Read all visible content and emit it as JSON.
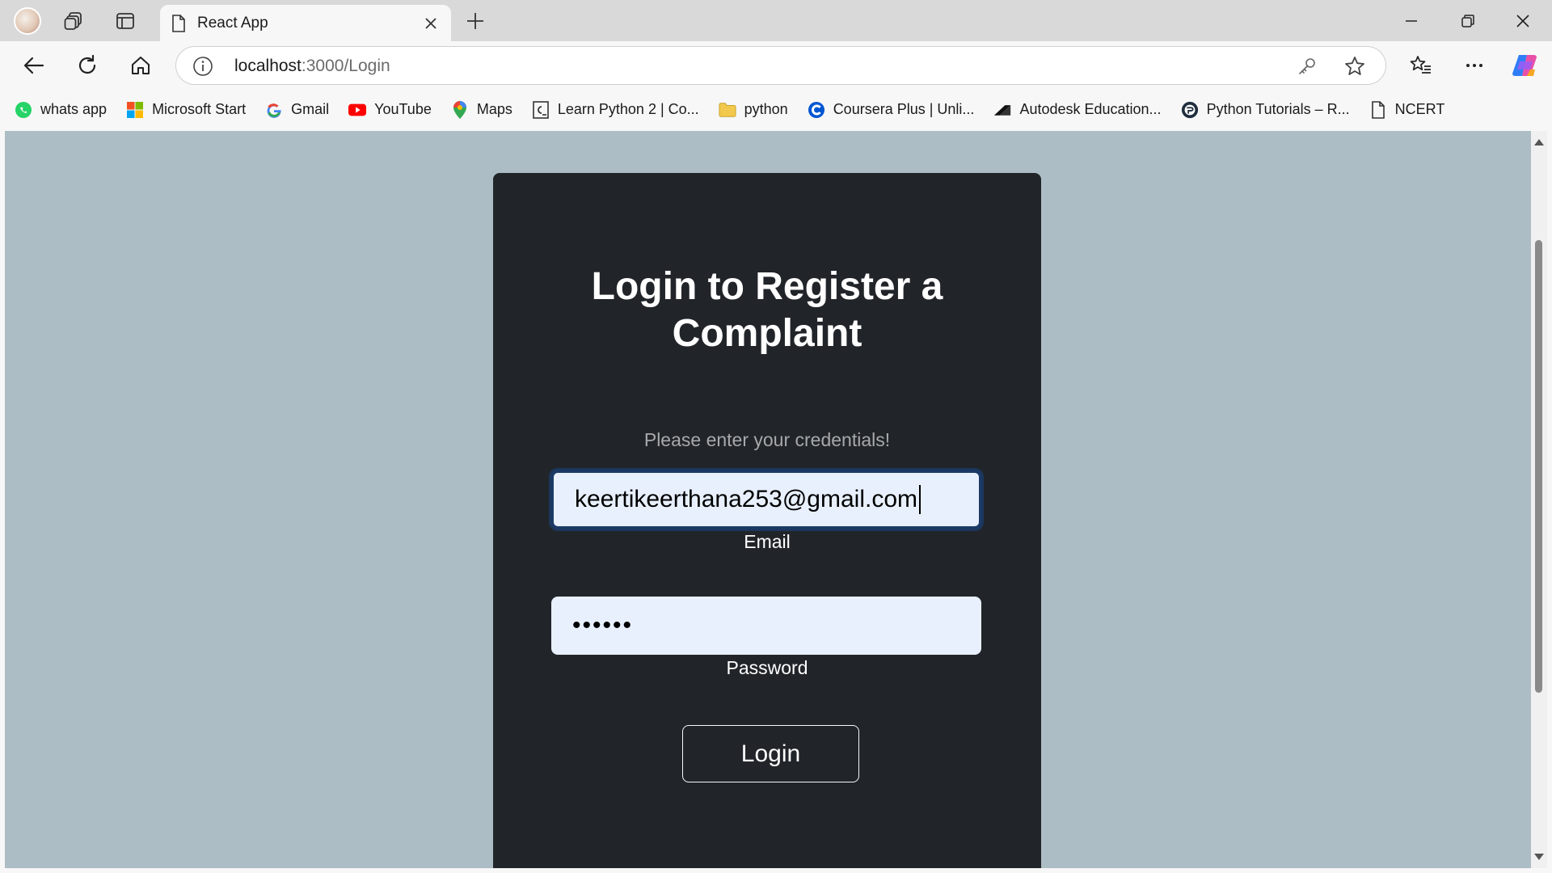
{
  "browser": {
    "tab": {
      "title": "React App",
      "icon": "page-icon"
    },
    "address": {
      "host": "localhost",
      "path": ":3000/Login"
    },
    "bookmarks": [
      {
        "label": "whats app",
        "icon": "whatsapp-icon",
        "color": "#25d366"
      },
      {
        "label": "Microsoft Start",
        "icon": "microsoft-icon",
        "color": "#f25022"
      },
      {
        "label": "Gmail",
        "icon": "google-icon",
        "color": "#4285f4"
      },
      {
        "label": "YouTube",
        "icon": "youtube-icon",
        "color": "#ff0000"
      },
      {
        "label": "Maps",
        "icon": "maps-pin-icon",
        "color": "#34a853"
      },
      {
        "label": "Learn Python 2 | Co...",
        "icon": "codecademy-icon",
        "color": "#333333"
      },
      {
        "label": "python",
        "icon": "folder-icon",
        "color": "#f2c94c"
      },
      {
        "label": "Coursera Plus | Unli...",
        "icon": "coursera-icon",
        "color": "#0056d2"
      },
      {
        "label": "Autodesk Education...",
        "icon": "autodesk-icon",
        "color": "#111111"
      },
      {
        "label": "Python Tutorials – R...",
        "icon": "realpython-icon",
        "color": "#1f2d3d"
      },
      {
        "label": "NCERT",
        "icon": "page-icon",
        "color": "#555555"
      }
    ]
  },
  "page": {
    "title": "Login to Register a Complaint",
    "subtitle": "Please enter your credentials!",
    "email": {
      "value": "keertikeerthana253@gmail.com",
      "label": "Email"
    },
    "password": {
      "value": "••••••",
      "label": "Password"
    },
    "login_label": "Login"
  },
  "colors": {
    "page_bg": "#adbdc5",
    "card_bg": "#212529",
    "input_bg": "#e8f0fe"
  }
}
